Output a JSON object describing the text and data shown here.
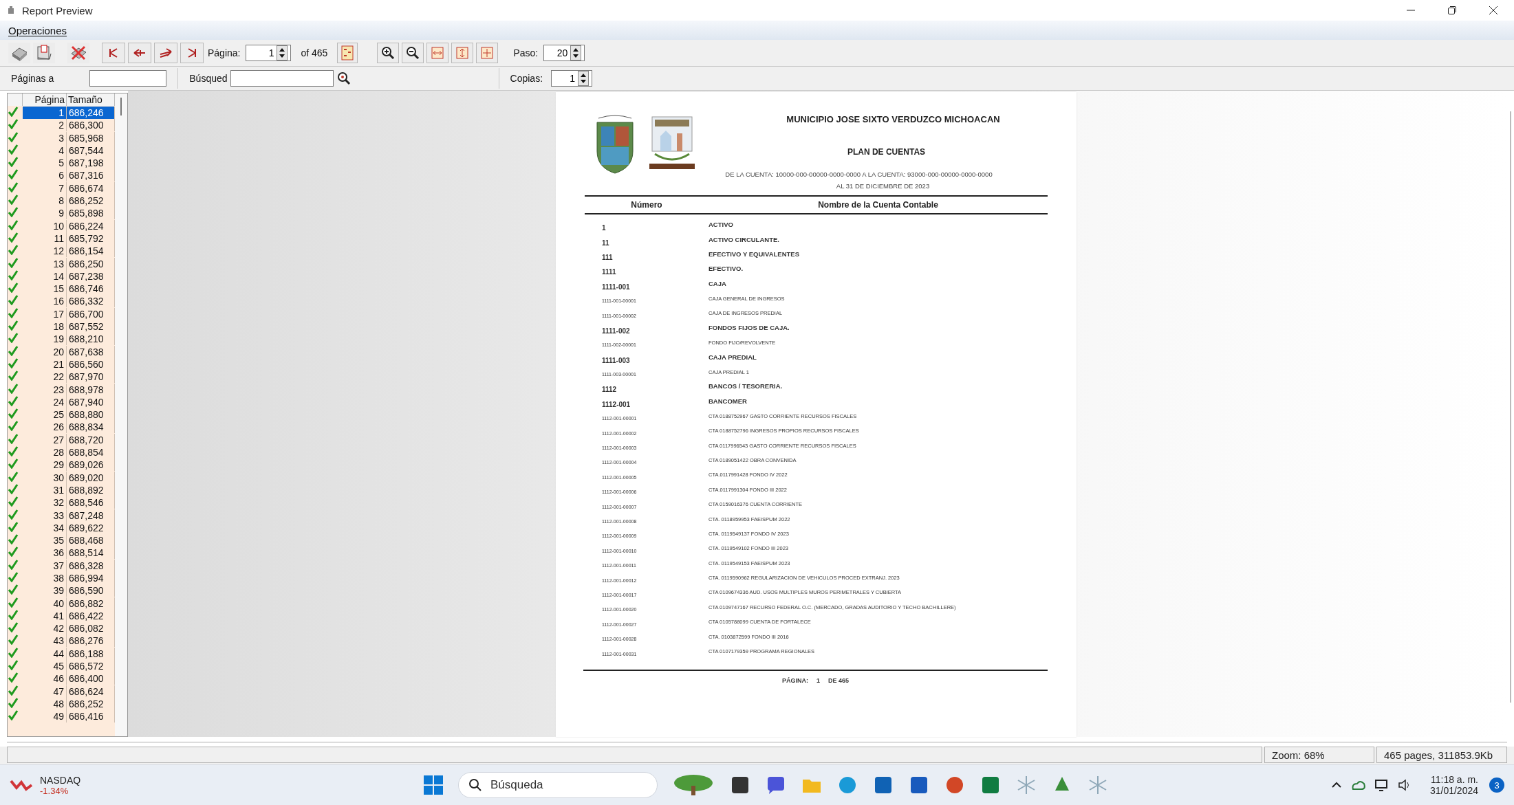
{
  "window": {
    "title": "Report Preview"
  },
  "menu": [
    {
      "label": "Operaciones"
    }
  ],
  "toolbar": {
    "page_label": "Página:",
    "page_value": "1",
    "page_total": "of 465",
    "step_label": "Paso:",
    "step_value": "20"
  },
  "toolbar2": {
    "pages_label": "Páginas a",
    "search_label": "Búsqued",
    "copies_label": "Copias:",
    "copies_value": "1"
  },
  "page_list": {
    "columns": [
      "Página",
      "Tamaño"
    ],
    "rows": [
      {
        "page": "1",
        "size": "686,246",
        "checked": true,
        "selected": true
      },
      {
        "page": "2",
        "size": "686,300",
        "checked": true,
        "selected": false
      },
      {
        "page": "3",
        "size": "685,968",
        "checked": true,
        "selected": false
      },
      {
        "page": "4",
        "size": "687,544",
        "checked": true,
        "selected": false
      },
      {
        "page": "5",
        "size": "687,198",
        "checked": true,
        "selected": false
      },
      {
        "page": "6",
        "size": "687,316",
        "checked": true,
        "selected": false
      },
      {
        "page": "7",
        "size": "686,674",
        "checked": true,
        "selected": false
      },
      {
        "page": "8",
        "size": "686,252",
        "checked": true,
        "selected": false
      },
      {
        "page": "9",
        "size": "685,898",
        "checked": true,
        "selected": false
      },
      {
        "page": "10",
        "size": "686,224",
        "checked": true,
        "selected": false
      },
      {
        "page": "11",
        "size": "685,792",
        "checked": true,
        "selected": false
      },
      {
        "page": "12",
        "size": "686,154",
        "checked": true,
        "selected": false
      },
      {
        "page": "13",
        "size": "686,250",
        "checked": true,
        "selected": false
      },
      {
        "page": "14",
        "size": "687,238",
        "checked": true,
        "selected": false
      },
      {
        "page": "15",
        "size": "686,746",
        "checked": true,
        "selected": false
      },
      {
        "page": "16",
        "size": "686,332",
        "checked": true,
        "selected": false
      },
      {
        "page": "17",
        "size": "686,700",
        "checked": true,
        "selected": false
      },
      {
        "page": "18",
        "size": "687,552",
        "checked": true,
        "selected": false
      },
      {
        "page": "19",
        "size": "688,210",
        "checked": true,
        "selected": false
      },
      {
        "page": "20",
        "size": "687,638",
        "checked": true,
        "selected": false
      },
      {
        "page": "21",
        "size": "686,560",
        "checked": true,
        "selected": false
      },
      {
        "page": "22",
        "size": "687,970",
        "checked": true,
        "selected": false
      },
      {
        "page": "23",
        "size": "688,978",
        "checked": true,
        "selected": false
      },
      {
        "page": "24",
        "size": "687,940",
        "checked": true,
        "selected": false
      },
      {
        "page": "25",
        "size": "688,880",
        "checked": true,
        "selected": false
      },
      {
        "page": "26",
        "size": "688,834",
        "checked": true,
        "selected": false
      },
      {
        "page": "27",
        "size": "688,720",
        "checked": true,
        "selected": false
      },
      {
        "page": "28",
        "size": "688,854",
        "checked": true,
        "selected": false
      },
      {
        "page": "29",
        "size": "689,026",
        "checked": true,
        "selected": false
      },
      {
        "page": "30",
        "size": "689,020",
        "checked": true,
        "selected": false
      },
      {
        "page": "31",
        "size": "688,892",
        "checked": true,
        "selected": false
      },
      {
        "page": "32",
        "size": "688,546",
        "checked": true,
        "selected": false
      },
      {
        "page": "33",
        "size": "687,248",
        "checked": true,
        "selected": false
      },
      {
        "page": "34",
        "size": "689,622",
        "checked": true,
        "selected": false
      },
      {
        "page": "35",
        "size": "688,468",
        "checked": true,
        "selected": false
      },
      {
        "page": "36",
        "size": "688,514",
        "checked": true,
        "selected": false
      },
      {
        "page": "37",
        "size": "686,328",
        "checked": true,
        "selected": false
      },
      {
        "page": "38",
        "size": "686,994",
        "checked": true,
        "selected": false
      },
      {
        "page": "39",
        "size": "686,590",
        "checked": true,
        "selected": false
      },
      {
        "page": "40",
        "size": "686,882",
        "checked": true,
        "selected": false
      },
      {
        "page": "41",
        "size": "686,422",
        "checked": true,
        "selected": false
      },
      {
        "page": "42",
        "size": "686,082",
        "checked": true,
        "selected": false
      },
      {
        "page": "43",
        "size": "686,276",
        "checked": true,
        "selected": false
      },
      {
        "page": "44",
        "size": "686,188",
        "checked": true,
        "selected": false
      },
      {
        "page": "45",
        "size": "686,572",
        "checked": true,
        "selected": false
      },
      {
        "page": "46",
        "size": "686,400",
        "checked": true,
        "selected": false
      },
      {
        "page": "47",
        "size": "686,624",
        "checked": true,
        "selected": false
      },
      {
        "page": "48",
        "size": "686,252",
        "checked": true,
        "selected": false
      },
      {
        "page": "49",
        "size": "686,416",
        "checked": true,
        "selected": false
      }
    ]
  },
  "report": {
    "title": "MUNICIPIO JOSE SIXTO VERDUZCO MICHOACAN",
    "subtitle": "PLAN DE CUENTAS",
    "range": "DE LA CUENTA: 10000-000-00000-0000-0000 A LA CUENTA: 93000-000-00000-0000-0000",
    "date": "AL 31 DE DICIEMBRE DE 2023",
    "columns": [
      "Número",
      "Nombre de la Cuenta Contable"
    ],
    "rows": [
      {
        "kind": "group",
        "number": "1",
        "name": "ACTIVO"
      },
      {
        "kind": "group",
        "number": "11",
        "name": "ACTIVO CIRCULANTE."
      },
      {
        "kind": "group",
        "number": "111",
        "name": "EFECTIVO Y EQUIVALENTES"
      },
      {
        "kind": "group",
        "number": "1111",
        "name": "EFECTIVO."
      },
      {
        "kind": "group",
        "number": "1111-001",
        "name": "CAJA"
      },
      {
        "kind": "detail",
        "number": "1111-001-00001",
        "name": "CAJA GENERAL DE INGRESOS"
      },
      {
        "kind": "detail",
        "number": "1111-001-00002",
        "name": "CAJA DE INGRESOS PREDIAL"
      },
      {
        "kind": "group",
        "number": "1111-002",
        "name": "FONDOS FIJOS DE CAJA."
      },
      {
        "kind": "detail",
        "number": "1111-002-00001",
        "name": "FONDO FIJO/REVOLVENTE"
      },
      {
        "kind": "group",
        "number": "1111-003",
        "name": "CAJA PREDIAL"
      },
      {
        "kind": "detail",
        "number": "1111-003-00001",
        "name": "CAJA PREDIAL 1"
      },
      {
        "kind": "group",
        "number": "1112",
        "name": "BANCOS / TESORERIA."
      },
      {
        "kind": "group",
        "number": "1112-001",
        "name": "BANCOMER"
      },
      {
        "kind": "detail",
        "number": "1112-001-00001",
        "name": "CTA 0188752967 GASTO CORRIENTE RECURSOS FISCALES"
      },
      {
        "kind": "detail",
        "number": "1112-001-00002",
        "name": "CTA 0188752796 INGRESOS PROPIOS RECURSOS FISCALES"
      },
      {
        "kind": "detail",
        "number": "1112-001-00003",
        "name": "CTA 0117996543 GASTO CORRIENTE RECURSOS FISCALES"
      },
      {
        "kind": "detail",
        "number": "1112-001-00004",
        "name": "CTA 0189051422 OBRA CONVENIDA"
      },
      {
        "kind": "detail",
        "number": "1112-001-00005",
        "name": "CTA.0117991428 FONDO IV 2022"
      },
      {
        "kind": "detail",
        "number": "1112-001-00006",
        "name": "CTA.0117991304 FONDO III 2022"
      },
      {
        "kind": "detail",
        "number": "1112-001-00007",
        "name": "CTA 0159016376 CUENTA CORRIENTE"
      },
      {
        "kind": "detail",
        "number": "1112-001-00008",
        "name": "CTA. 0118959953 FAEISPUM 2022"
      },
      {
        "kind": "detail",
        "number": "1112-001-00009",
        "name": "CTA. 0119549137 FONDO IV 2023"
      },
      {
        "kind": "detail",
        "number": "1112-001-00010",
        "name": "CTA. 0119549102 FONDO III 2023"
      },
      {
        "kind": "detail",
        "number": "1112-001-00011",
        "name": "CTA. 0119549153 FAEISPUM 2023"
      },
      {
        "kind": "detail",
        "number": "1112-001-00012",
        "name": "CTA. 0119590962 REGULARIZACION DE VEHICULOS PROCED EXTRANJ. 2023"
      },
      {
        "kind": "detail",
        "number": "1112-001-00017",
        "name": "CTA 0109674336 AUD. USOS MULTIPLES MUROS PERIMETRALES Y CUBIERTA"
      },
      {
        "kind": "detail",
        "number": "1112-001-00020",
        "name": "CTA 0109747167 RECURSO FEDERAL O.C. (MERCADO, GRADAS AUDITORIO Y TECHO BACHILLERE)"
      },
      {
        "kind": "detail",
        "number": "1112-001-00027",
        "name": "CTA 0105788099 CUENTA DE FORTALECE"
      },
      {
        "kind": "detail",
        "number": "1112-001-00028",
        "name": "CTA. 0103872599 FONDO III 2016"
      },
      {
        "kind": "detail",
        "number": "1112-001-00031",
        "name": "CTA 0107179359 PROGRAMA REGIONALES"
      }
    ],
    "footer": {
      "label": "PÁGINA:",
      "page": "1",
      "total": "DE 465"
    }
  },
  "status_bar": {
    "zoom": "Zoom: 68%",
    "info": "465 pages, 311853.9Kb"
  },
  "taskbar": {
    "stock_name": "NASDAQ",
    "stock_change": "-1.34%",
    "search_placeholder": "Búsqueda",
    "time": "11:18 a. m.",
    "date": "31/01/2024",
    "notification_count": "3"
  }
}
